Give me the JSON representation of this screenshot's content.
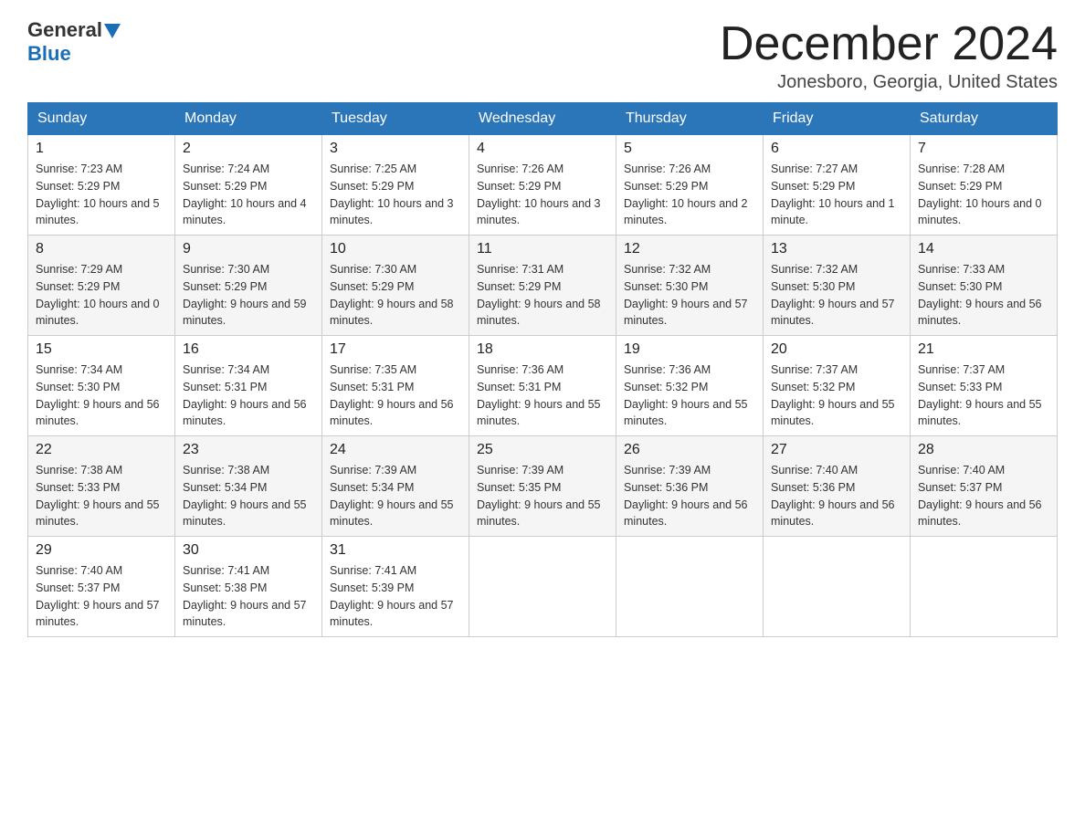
{
  "header": {
    "logo_general": "General",
    "logo_blue": "Blue",
    "month_title": "December 2024",
    "location": "Jonesboro, Georgia, United States"
  },
  "days_of_week": [
    "Sunday",
    "Monday",
    "Tuesday",
    "Wednesday",
    "Thursday",
    "Friday",
    "Saturday"
  ],
  "weeks": [
    [
      {
        "day": "1",
        "sunrise": "7:23 AM",
        "sunset": "5:29 PM",
        "daylight": "10 hours and 5 minutes."
      },
      {
        "day": "2",
        "sunrise": "7:24 AM",
        "sunset": "5:29 PM",
        "daylight": "10 hours and 4 minutes."
      },
      {
        "day": "3",
        "sunrise": "7:25 AM",
        "sunset": "5:29 PM",
        "daylight": "10 hours and 3 minutes."
      },
      {
        "day": "4",
        "sunrise": "7:26 AM",
        "sunset": "5:29 PM",
        "daylight": "10 hours and 3 minutes."
      },
      {
        "day": "5",
        "sunrise": "7:26 AM",
        "sunset": "5:29 PM",
        "daylight": "10 hours and 2 minutes."
      },
      {
        "day": "6",
        "sunrise": "7:27 AM",
        "sunset": "5:29 PM",
        "daylight": "10 hours and 1 minute."
      },
      {
        "day": "7",
        "sunrise": "7:28 AM",
        "sunset": "5:29 PM",
        "daylight": "10 hours and 0 minutes."
      }
    ],
    [
      {
        "day": "8",
        "sunrise": "7:29 AM",
        "sunset": "5:29 PM",
        "daylight": "10 hours and 0 minutes."
      },
      {
        "day": "9",
        "sunrise": "7:30 AM",
        "sunset": "5:29 PM",
        "daylight": "9 hours and 59 minutes."
      },
      {
        "day": "10",
        "sunrise": "7:30 AM",
        "sunset": "5:29 PM",
        "daylight": "9 hours and 58 minutes."
      },
      {
        "day": "11",
        "sunrise": "7:31 AM",
        "sunset": "5:29 PM",
        "daylight": "9 hours and 58 minutes."
      },
      {
        "day": "12",
        "sunrise": "7:32 AM",
        "sunset": "5:30 PM",
        "daylight": "9 hours and 57 minutes."
      },
      {
        "day": "13",
        "sunrise": "7:32 AM",
        "sunset": "5:30 PM",
        "daylight": "9 hours and 57 minutes."
      },
      {
        "day": "14",
        "sunrise": "7:33 AM",
        "sunset": "5:30 PM",
        "daylight": "9 hours and 56 minutes."
      }
    ],
    [
      {
        "day": "15",
        "sunrise": "7:34 AM",
        "sunset": "5:30 PM",
        "daylight": "9 hours and 56 minutes."
      },
      {
        "day": "16",
        "sunrise": "7:34 AM",
        "sunset": "5:31 PM",
        "daylight": "9 hours and 56 minutes."
      },
      {
        "day": "17",
        "sunrise": "7:35 AM",
        "sunset": "5:31 PM",
        "daylight": "9 hours and 56 minutes."
      },
      {
        "day": "18",
        "sunrise": "7:36 AM",
        "sunset": "5:31 PM",
        "daylight": "9 hours and 55 minutes."
      },
      {
        "day": "19",
        "sunrise": "7:36 AM",
        "sunset": "5:32 PM",
        "daylight": "9 hours and 55 minutes."
      },
      {
        "day": "20",
        "sunrise": "7:37 AM",
        "sunset": "5:32 PM",
        "daylight": "9 hours and 55 minutes."
      },
      {
        "day": "21",
        "sunrise": "7:37 AM",
        "sunset": "5:33 PM",
        "daylight": "9 hours and 55 minutes."
      }
    ],
    [
      {
        "day": "22",
        "sunrise": "7:38 AM",
        "sunset": "5:33 PM",
        "daylight": "9 hours and 55 minutes."
      },
      {
        "day": "23",
        "sunrise": "7:38 AM",
        "sunset": "5:34 PM",
        "daylight": "9 hours and 55 minutes."
      },
      {
        "day": "24",
        "sunrise": "7:39 AM",
        "sunset": "5:34 PM",
        "daylight": "9 hours and 55 minutes."
      },
      {
        "day": "25",
        "sunrise": "7:39 AM",
        "sunset": "5:35 PM",
        "daylight": "9 hours and 55 minutes."
      },
      {
        "day": "26",
        "sunrise": "7:39 AM",
        "sunset": "5:36 PM",
        "daylight": "9 hours and 56 minutes."
      },
      {
        "day": "27",
        "sunrise": "7:40 AM",
        "sunset": "5:36 PM",
        "daylight": "9 hours and 56 minutes."
      },
      {
        "day": "28",
        "sunrise": "7:40 AM",
        "sunset": "5:37 PM",
        "daylight": "9 hours and 56 minutes."
      }
    ],
    [
      {
        "day": "29",
        "sunrise": "7:40 AM",
        "sunset": "5:37 PM",
        "daylight": "9 hours and 57 minutes."
      },
      {
        "day": "30",
        "sunrise": "7:41 AM",
        "sunset": "5:38 PM",
        "daylight": "9 hours and 57 minutes."
      },
      {
        "day": "31",
        "sunrise": "7:41 AM",
        "sunset": "5:39 PM",
        "daylight": "9 hours and 57 minutes."
      },
      null,
      null,
      null,
      null
    ]
  ]
}
